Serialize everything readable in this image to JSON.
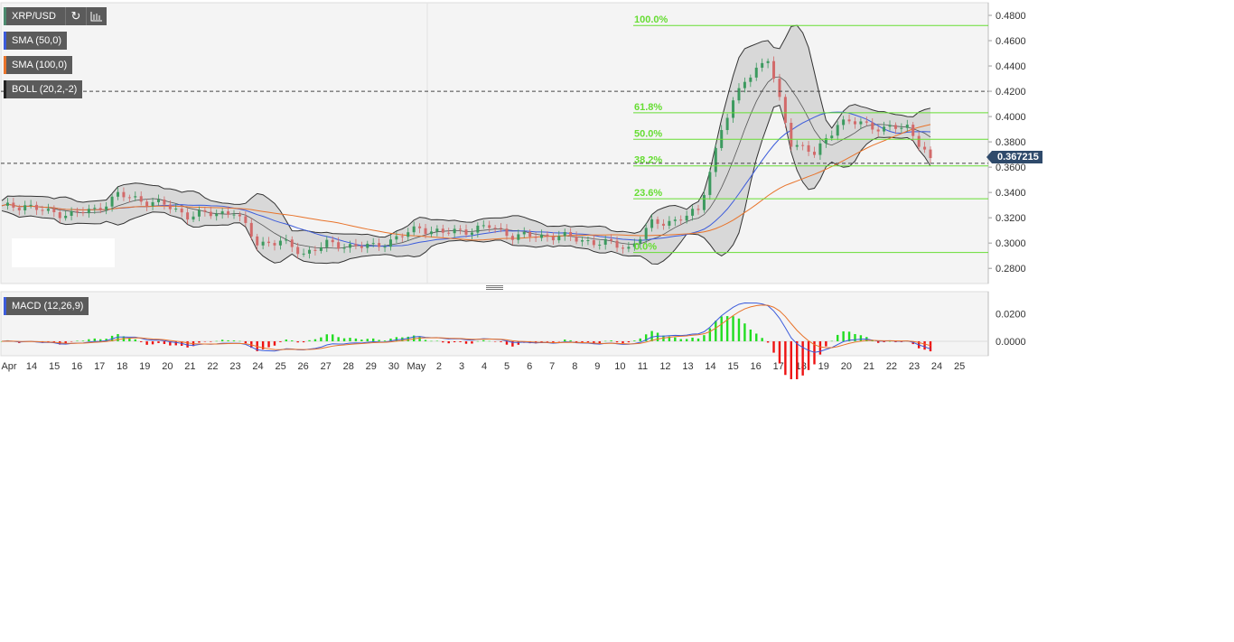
{
  "chart_data": {
    "type": "candlestick",
    "symbol": "XRP/USD",
    "last_price": "0.367215",
    "y_axis": {
      "ticks": [
        "0.4800",
        "0.4600",
        "0.4400",
        "0.4200",
        "0.4000",
        "0.3800",
        "0.3600",
        "0.3400",
        "0.3200",
        "0.3000",
        "0.2800"
      ],
      "ylim": [
        0.268,
        0.49
      ]
    },
    "x_axis": {
      "ticks": [
        "Apr",
        "14",
        "15",
        "16",
        "17",
        "18",
        "19",
        "20",
        "21",
        "22",
        "23",
        "24",
        "25",
        "26",
        "27",
        "28",
        "29",
        "30",
        "May",
        "2",
        "3",
        "4",
        "5",
        "6",
        "7",
        "8",
        "9",
        "10",
        "11",
        "12",
        "13",
        "14",
        "15",
        "16",
        "17",
        "18",
        "19",
        "20",
        "21",
        "22",
        "23",
        "24",
        "25"
      ]
    },
    "indicators": [
      {
        "label": "SMA (50,0)",
        "color": "#3b5bdb"
      },
      {
        "label": "SMA (100,0)",
        "color": "#e8732a"
      },
      {
        "label": "BOLL (20,2,-2)",
        "color": "#333333"
      }
    ],
    "fibonacci": {
      "levels": [
        {
          "label": "100.0%",
          "price": 0.472
        },
        {
          "label": "61.8%",
          "price": 0.403
        },
        {
          "label": "50.0%",
          "price": 0.382
        },
        {
          "label": "38.2%",
          "price": 0.361
        },
        {
          "label": "23.6%",
          "price": 0.335
        },
        {
          "label": "0.0%",
          "price": 0.2925
        }
      ],
      "color": "#66dd33"
    },
    "horizontal_lines": [
      0.42,
      0.363
    ],
    "close_series": [
      {
        "date": "Apr 13",
        "close": 0.328
      },
      {
        "date": "Apr 14",
        "close": 0.33
      },
      {
        "date": "Apr 15",
        "close": 0.324
      },
      {
        "date": "Apr 16",
        "close": 0.323
      },
      {
        "date": "Apr 17",
        "close": 0.326
      },
      {
        "date": "Apr 18",
        "close": 0.338
      },
      {
        "date": "Apr 19",
        "close": 0.334
      },
      {
        "date": "Apr 20",
        "close": 0.33
      },
      {
        "date": "Apr 21",
        "close": 0.322
      },
      {
        "date": "Apr 22",
        "close": 0.323
      },
      {
        "date": "Apr 23",
        "close": 0.325
      },
      {
        "date": "Apr 24",
        "close": 0.3
      },
      {
        "date": "Apr 25",
        "close": 0.301
      },
      {
        "date": "Apr 26",
        "close": 0.292
      },
      {
        "date": "Apr 27",
        "close": 0.299
      },
      {
        "date": "Apr 28",
        "close": 0.298
      },
      {
        "date": "Apr 29",
        "close": 0.297
      },
      {
        "date": "Apr 30",
        "close": 0.304
      },
      {
        "date": "May 1",
        "close": 0.312
      },
      {
        "date": "May 2",
        "close": 0.308
      },
      {
        "date": "May 3",
        "close": 0.31
      },
      {
        "date": "May 4",
        "close": 0.313
      },
      {
        "date": "May 5",
        "close": 0.306
      },
      {
        "date": "May 6",
        "close": 0.305
      },
      {
        "date": "May 7",
        "close": 0.306
      },
      {
        "date": "May 8",
        "close": 0.302
      },
      {
        "date": "May 9",
        "close": 0.3
      },
      {
        "date": "May 10",
        "close": 0.296
      },
      {
        "date": "May 11",
        "close": 0.315
      },
      {
        "date": "May 12",
        "close": 0.318
      },
      {
        "date": "May 13",
        "close": 0.325
      },
      {
        "date": "May 14",
        "close": 0.39
      },
      {
        "date": "May 15",
        "close": 0.43
      },
      {
        "date": "May 16",
        "close": 0.445
      },
      {
        "date": "May 17",
        "close": 0.38
      },
      {
        "date": "May 18",
        "close": 0.37
      },
      {
        "date": "May 19",
        "close": 0.395
      },
      {
        "date": "May 20",
        "close": 0.395
      },
      {
        "date": "May 21",
        "close": 0.39
      },
      {
        "date": "May 22",
        "close": 0.392
      },
      {
        "date": "May 23",
        "close": 0.3672
      }
    ],
    "macd": {
      "label": "MACD (12,26,9)",
      "y_ticks": [
        "0.0200",
        "0.0000"
      ],
      "ylim": [
        -0.0105,
        0.036
      ]
    }
  }
}
